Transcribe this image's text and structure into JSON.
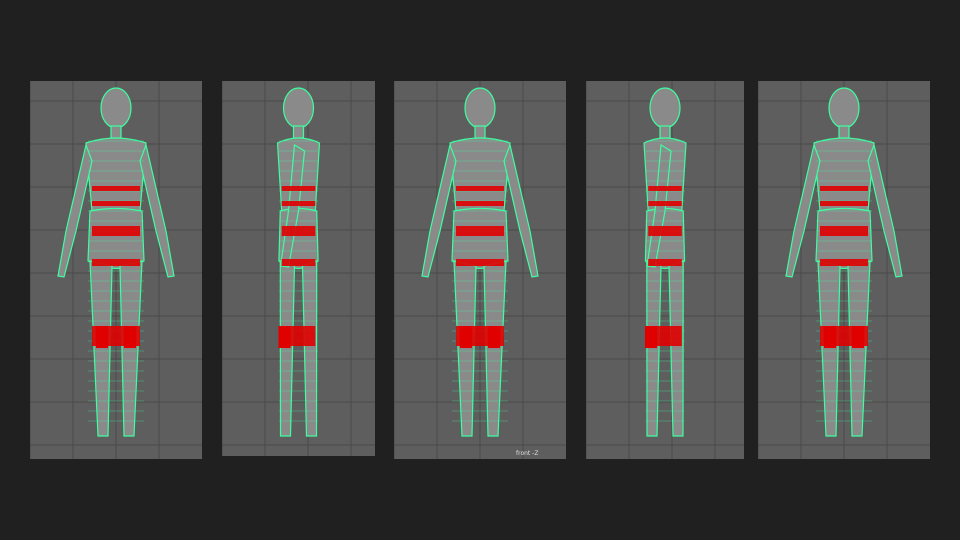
{
  "panels": [
    {
      "view": "back"
    },
    {
      "view": "side-left"
    },
    {
      "view": "front",
      "label": "front -Z"
    },
    {
      "view": "side-right"
    },
    {
      "view": "perspective"
    }
  ],
  "colors": {
    "background": "#202020",
    "viewport": "#5e5e5e",
    "wire": "#3dffa0",
    "highlight": "#e00000"
  }
}
